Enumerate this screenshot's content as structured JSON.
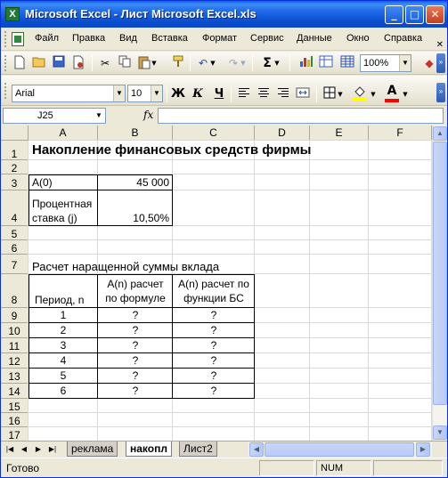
{
  "window": {
    "title": "Microsoft Excel - Лист Microsoft Excel.xls",
    "minimize_glyph": "_",
    "maximize_glyph": "□",
    "close_glyph": "✕"
  },
  "menu": {
    "items": [
      "Файл",
      "Правка",
      "Вид",
      "Вставка",
      "Формат",
      "Сервис",
      "Данные",
      "Окно",
      "Справка"
    ],
    "close_doc_glyph": "✕"
  },
  "toolbar_standard": {
    "zoom": "100%",
    "icons": [
      "new-file-icon",
      "open-folder-icon",
      "save-icon",
      "permission-icon",
      "cut-icon",
      "copy-icon",
      "paste-icon",
      "format-painter-icon",
      "undo-icon",
      "redo-icon",
      "autosum-icon",
      "chart-wizard-icon",
      "insert-table-icon",
      "worksheet-icon"
    ]
  },
  "toolbar_format": {
    "font_name": "Arial",
    "font_size": "10",
    "bold_label": "Ж",
    "italic_label": "К",
    "underline_label": "Ч",
    "fill_color": "#FFFF00",
    "font_color": "#FF0000"
  },
  "formula_bar": {
    "name_box": "J25",
    "fx_label": "fx",
    "formula": ""
  },
  "columns": [
    "A",
    "B",
    "C",
    "D",
    "E",
    "F"
  ],
  "rows": [
    "1",
    "2",
    "3",
    "4",
    "5",
    "6",
    "7",
    "8",
    "9",
    "10",
    "11",
    "12",
    "13",
    "14",
    "15",
    "16",
    "17"
  ],
  "sheet": {
    "title": "Накопление финансовых средств фирмы",
    "a0_label": "A(0)",
    "a0_value": "45 000",
    "rate_label_line1": "Процентная",
    "rate_label_line2": "ставка (j)",
    "rate_value": "10,50%",
    "section_title": "Расчет наращенной суммы вклада",
    "header_period": "Период, n",
    "header_formula_line1": "A(n) расчет",
    "header_formula_line2": "по формуле",
    "header_fv_line1": "A(n) расчет по",
    "header_fv_line2": "функции БС",
    "table_rows": [
      {
        "period": "1",
        "formula": "?",
        "fv": "?"
      },
      {
        "period": "2",
        "formula": "?",
        "fv": "?"
      },
      {
        "period": "3",
        "formula": "?",
        "fv": "?"
      },
      {
        "period": "4",
        "formula": "?",
        "fv": "?"
      },
      {
        "period": "5",
        "formula": "?",
        "fv": "?"
      },
      {
        "period": "6",
        "formula": "?",
        "fv": "?"
      }
    ]
  },
  "tabs": {
    "items": [
      "реклама",
      "накопл",
      "Лист2"
    ],
    "active": "накопл"
  },
  "status": {
    "ready": "Готово",
    "num": "NUM"
  }
}
